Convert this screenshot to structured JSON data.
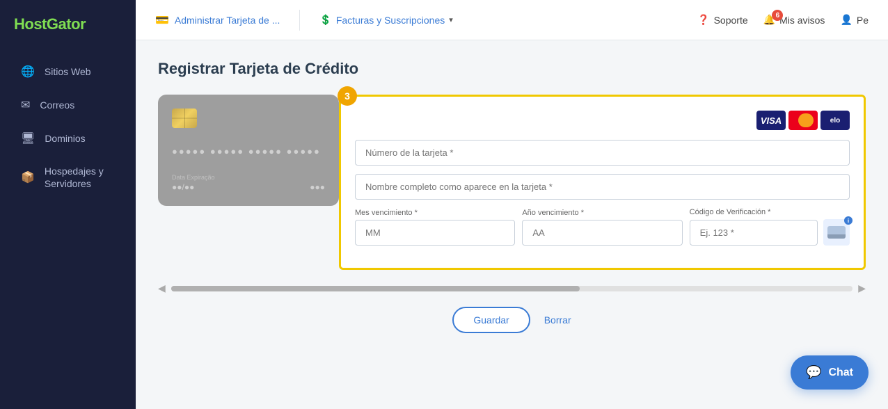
{
  "brand": {
    "name_part1": "Host",
    "name_part2": "Gator"
  },
  "sidebar": {
    "items": [
      {
        "id": "sitios-web",
        "label": "Sitios Web",
        "icon": "🌐"
      },
      {
        "id": "correos",
        "label": "Correos",
        "icon": "✉"
      },
      {
        "id": "dominios",
        "label": "Dominios",
        "icon": "🖥"
      },
      {
        "id": "hospedajes",
        "label": "Hospedajes y Servidores",
        "icon": "📦"
      }
    ]
  },
  "topbar": {
    "page_title": "Administrar Tarjeta de ...",
    "billing_label": "Facturas y Suscripciones",
    "support_label": "Soporte",
    "notifications_label": "Mis avisos",
    "notifications_count": "6",
    "profile_label": "Pe"
  },
  "main": {
    "page_heading": "Registrar Tarjeta de Crédito",
    "step_number": "3"
  },
  "card_visual": {
    "number_dots": "●●●●● ●●●●● ●●●●● ●●●●●",
    "expiry_label": "Data Expiração",
    "expiry_value": "●●/●●",
    "cvv_dots": "●●●"
  },
  "form": {
    "card_number_placeholder": "Número de la tarjeta *",
    "cardholder_placeholder": "Nombre completo como aparece en la tarjeta *",
    "month_label": "Mes vencimiento *",
    "month_placeholder": "MM",
    "year_label": "Año vencimiento *",
    "year_placeholder": "AA",
    "cvv_label": "Código de Verificación *",
    "cvv_placeholder": "Ej. 123 *"
  },
  "buttons": {
    "save": "Guardar",
    "delete": "Borrar"
  },
  "chat": {
    "label": "Chat"
  }
}
